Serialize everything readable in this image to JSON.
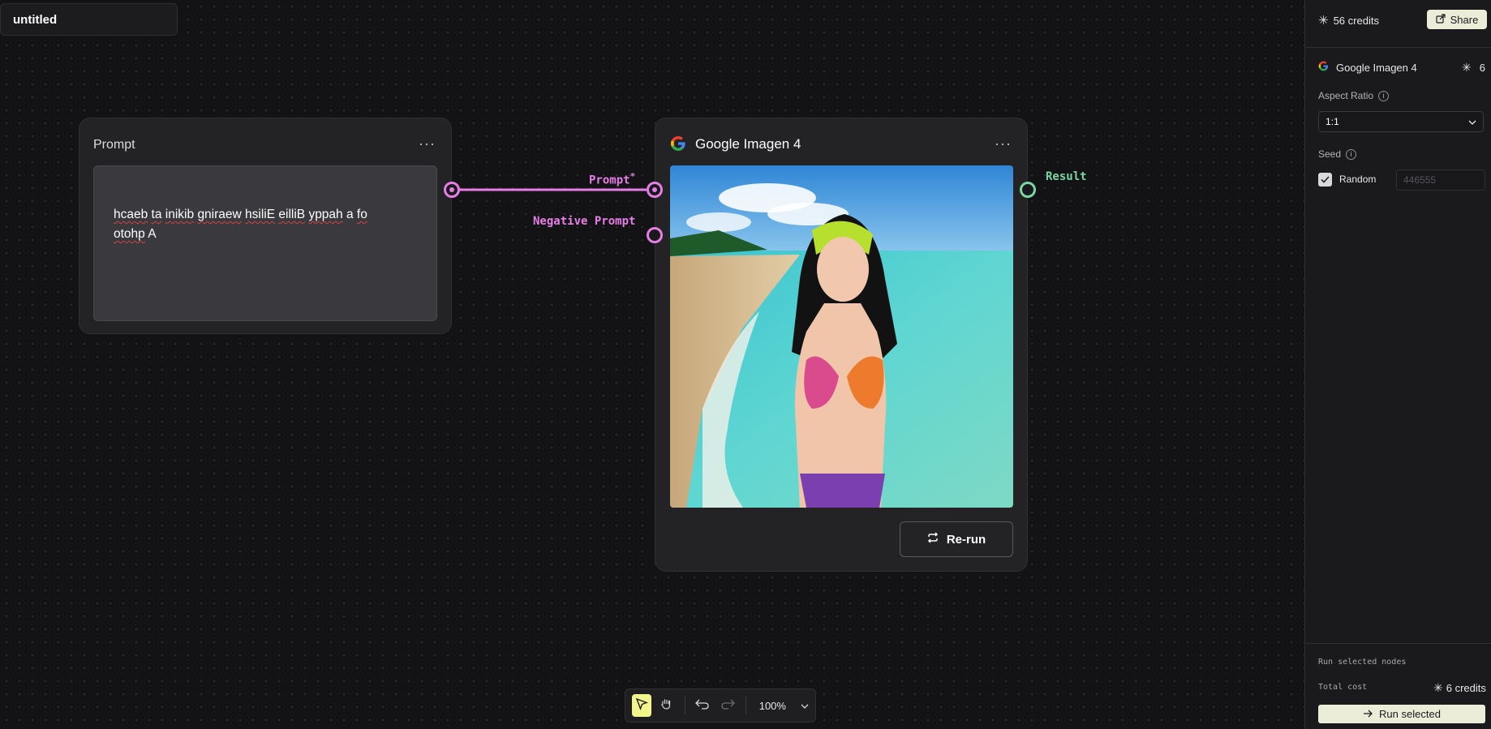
{
  "document": {
    "title": "untitled"
  },
  "prompt_node": {
    "title": "Prompt",
    "text_line1": [
      "hcaeb",
      "ta",
      "inikib",
      "gniraew",
      "hsiliE",
      "eilliB",
      "yppah",
      "a",
      "fo"
    ],
    "text_line2": [
      "otohp",
      "A"
    ],
    "menu_glyph": "···"
  },
  "imagen_node": {
    "title": "Google Imagen 4",
    "menu_glyph": "···",
    "rerun_label": "Re-run",
    "inputs": {
      "prompt_label": "Prompt",
      "required_mark": "*",
      "negative_label": "Negative Prompt"
    },
    "output_label": "Result"
  },
  "right_panel": {
    "credits": "56 credits",
    "share_label": "Share",
    "model_name": "Google Imagen 4",
    "model_cost": "6",
    "aspect_ratio_label": "Aspect Ratio",
    "aspect_ratio_value": "1:1",
    "seed_label": "Seed",
    "random_label": "Random",
    "random_checked": true,
    "seed_placeholder": "446555",
    "run_selected_heading": "Run selected nodes",
    "total_cost_label": "Total cost",
    "total_cost_value": "6 credits",
    "run_selected_label": "Run selected"
  },
  "toolbar": {
    "zoom": "100%"
  },
  "colors": {
    "port_pink": "#e77ee6",
    "port_green": "#7ad6a3",
    "accent_cream": "#ecedd9",
    "select_yellow": "#f2f58c",
    "canvas_bg": "#131316"
  },
  "icons": [
    "asterisk-icon",
    "share-icon",
    "google-g-icon",
    "info-icon",
    "chevron-down-icon",
    "check-icon",
    "arrow-right-icon",
    "repeat-icon",
    "cursor-icon",
    "hand-icon",
    "undo-icon",
    "redo-icon"
  ]
}
